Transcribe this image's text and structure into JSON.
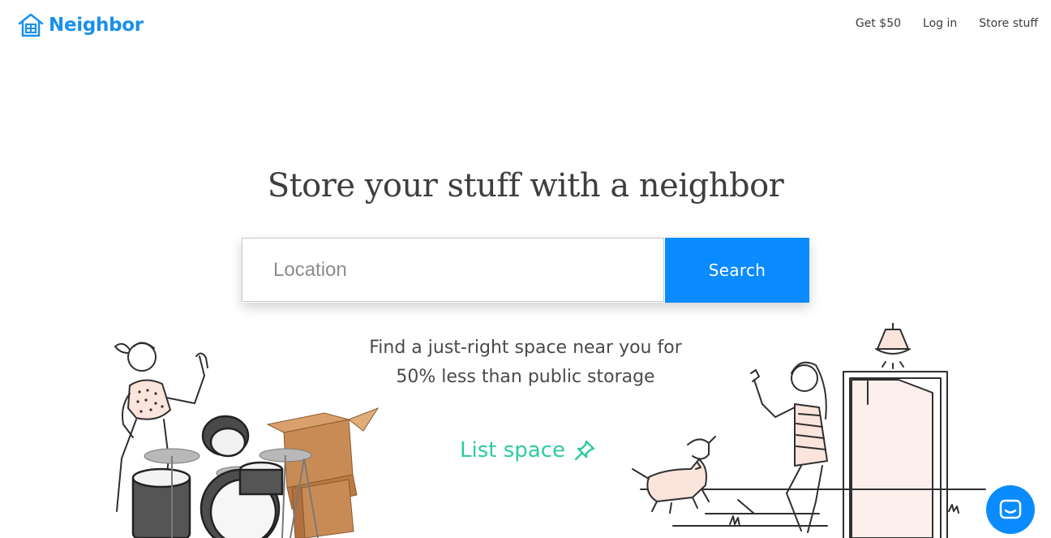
{
  "header": {
    "brand": "Neighbor",
    "nav": [
      {
        "label": "Get $50"
      },
      {
        "label": "Log in"
      },
      {
        "label": "Store stuff"
      }
    ]
  },
  "hero": {
    "headline": "Store your stuff with a neighbor",
    "search": {
      "placeholder": "Location",
      "value": "",
      "button_label": "Search"
    },
    "tagline": "Find a just-right space near you for 50% less than public storage",
    "list_space_label": "List space"
  },
  "colors": {
    "brand": "#1a90ee",
    "accent_button": "#0a8bff",
    "list_space": "#2ecba0",
    "text": "#3e3e3e"
  },
  "icons": {
    "logo": "house-icon",
    "list_space": "pushpin-icon",
    "chat": "chat-bubble-icon"
  }
}
